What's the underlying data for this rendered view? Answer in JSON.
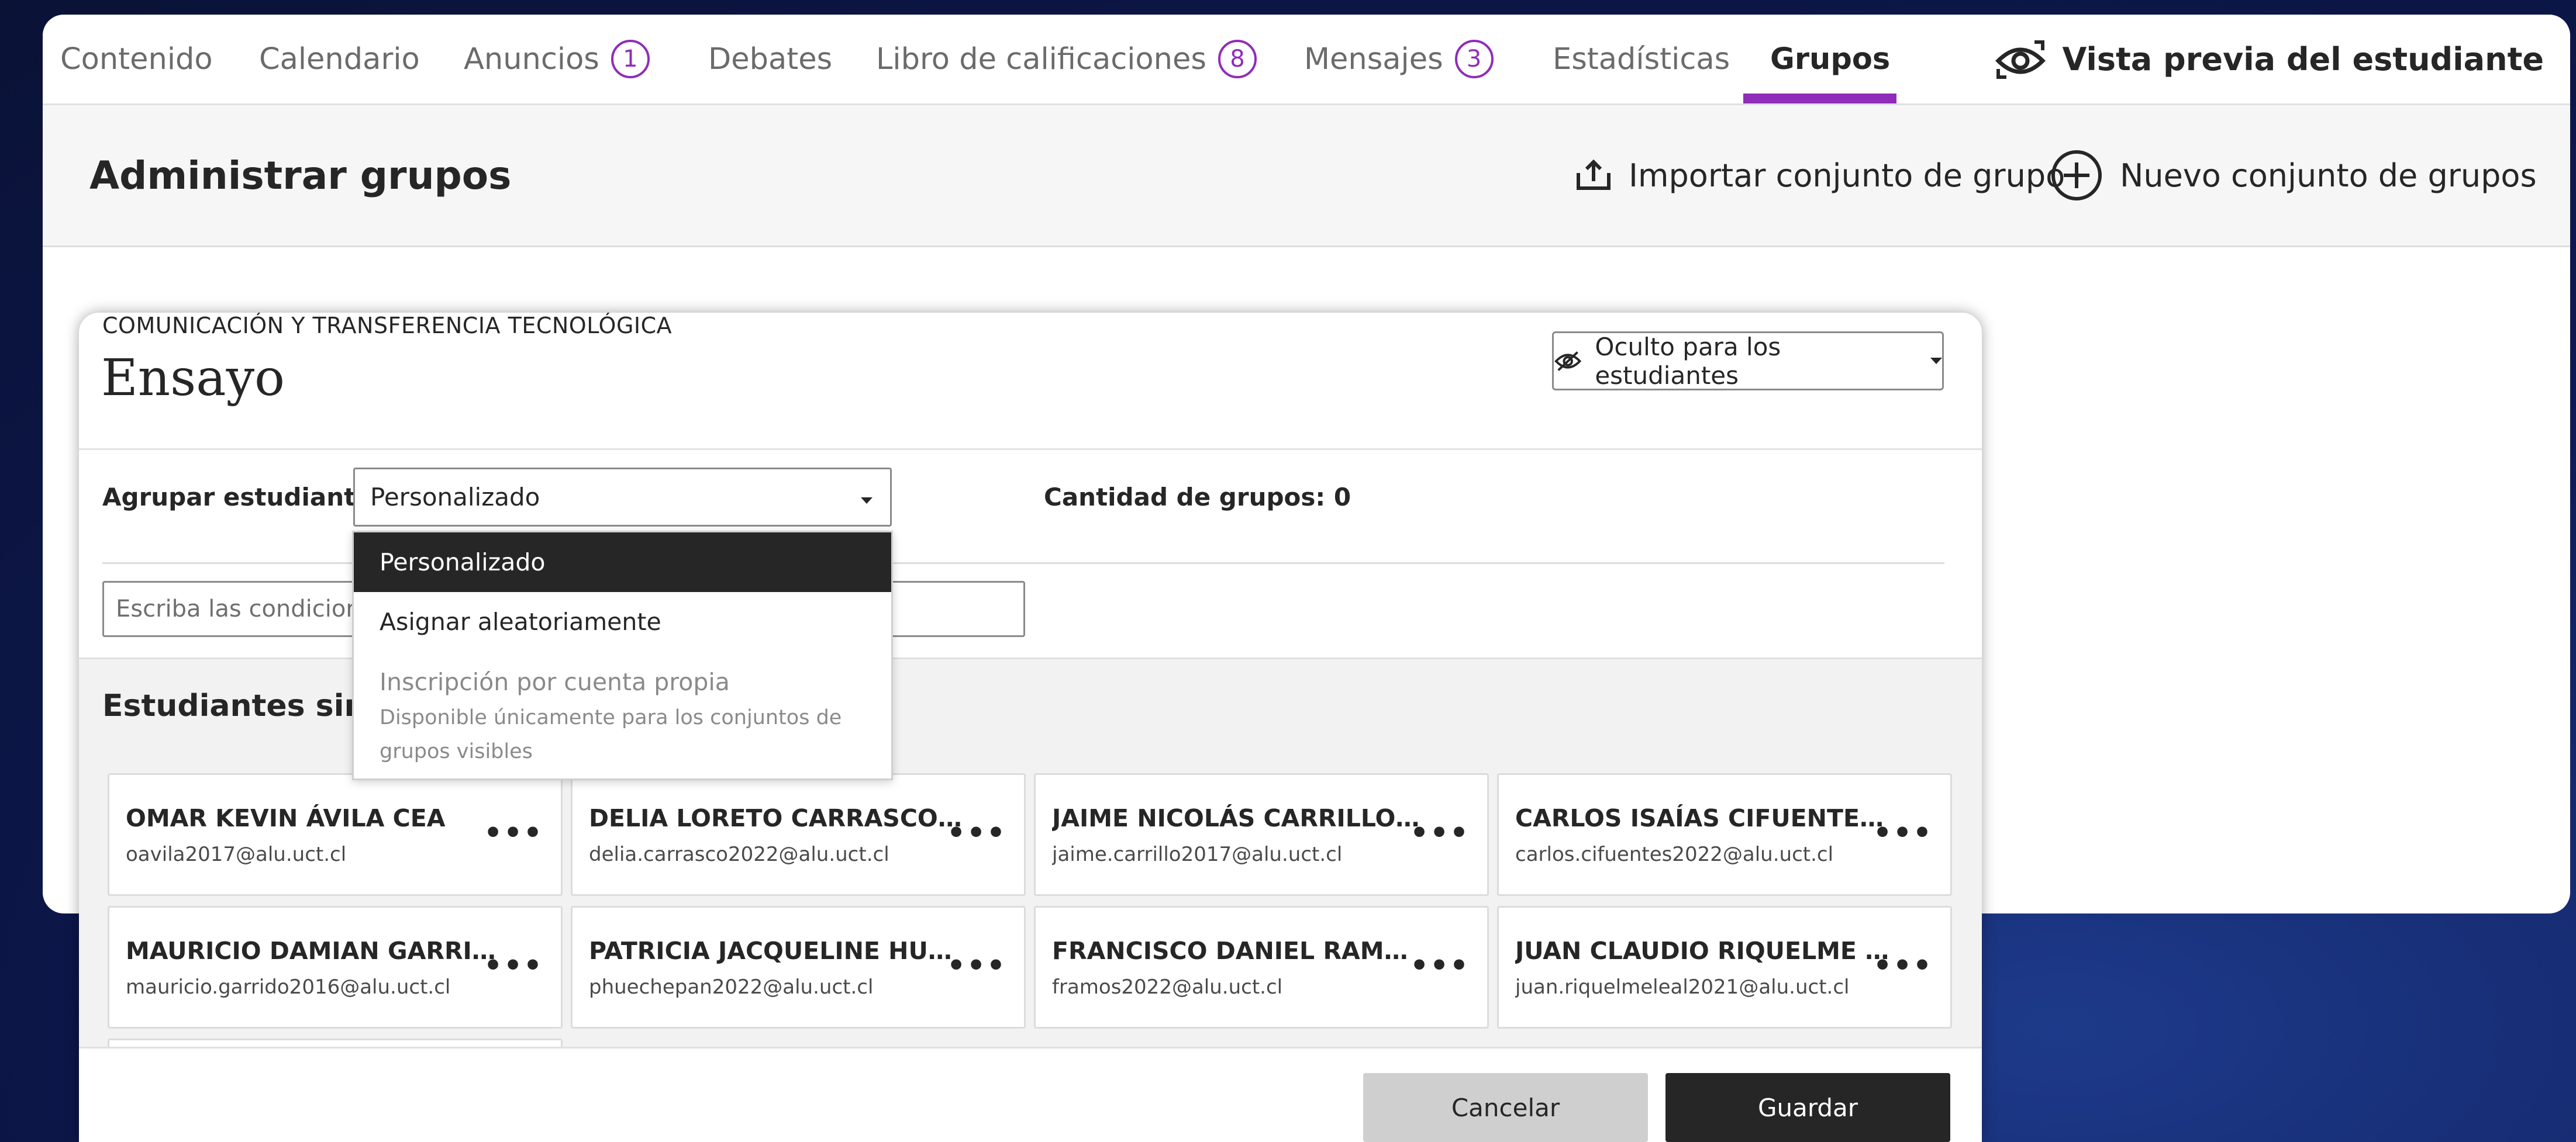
{
  "nav": {
    "tabs": [
      {
        "label": "Contenido"
      },
      {
        "label": "Calendario"
      },
      {
        "label": "Anuncios",
        "badge": "1"
      },
      {
        "label": "Debates"
      },
      {
        "label": "Libro de calificaciones",
        "badge": "8"
      },
      {
        "label": "Mensajes",
        "badge": "3"
      },
      {
        "label": "Estadísticas"
      },
      {
        "label": "Grupos",
        "active": true
      }
    ],
    "preview_label": "Vista previa del estudiante"
  },
  "admin": {
    "title": "Administrar grupos",
    "import_label": "Importar conjunto de grupo",
    "new_label": "Nuevo conjunto de grupos"
  },
  "panel": {
    "subtitle": "COMUNICACIÓN Y TRANSFERENCIA TECNOLÓGICA",
    "title": "Ensayo",
    "visibility_label": "Oculto para los estudiantes",
    "group_students_label": "Agrupar estudiantes",
    "group_select_value": "Personalizado",
    "group_count_label": "Cantidad de grupos: 0",
    "conditions_placeholder": "Escriba las condiciones",
    "unassigned_heading": "Estudiantes sin asignar",
    "cancel_label": "Cancelar",
    "save_label": "Guardar"
  },
  "dropdown": {
    "options": [
      {
        "label": "Personalizado",
        "selected": true
      },
      {
        "label": "Asignar aleatoriamente"
      },
      {
        "label": "Inscripción por cuenta propia",
        "disabled": true
      }
    ],
    "disabled_help": "Disponible únicamente para los conjuntos de grupos visibles"
  },
  "students": [
    {
      "name": "OMAR KEVIN ÁVILA CEA",
      "email": "oavila2017@alu.uct.cl"
    },
    {
      "name": "DELIA LORETO CARRASCO DÍAZ",
      "email": "delia.carrasco2022@alu.uct.cl"
    },
    {
      "name": "JAIME NICOLÁS CARRILLO ELGU...",
      "email": "jaime.carrillo2017@alu.uct.cl"
    },
    {
      "name": "CARLOS ISAÍAS CIFUENTES BÓR...",
      "email": "carlos.cifuentes2022@alu.uct.cl"
    },
    {
      "name": "MAURICIO DAMIAN GARRIDO M...",
      "email": "mauricio.garrido2016@alu.uct.cl"
    },
    {
      "name": "PATRICIA JACQUELINE HUECHEP...",
      "email": "phuechepan2022@alu.uct.cl"
    },
    {
      "name": "FRANCISCO DANIEL RAMOS REU...",
      "email": "framos2022@alu.uct.cl"
    },
    {
      "name": "JUAN CLAUDIO RIQUELME LEAL",
      "email": "juan.riquelmeleal2021@alu.uct.cl"
    }
  ],
  "card_more_label": "•••",
  "colors": {
    "accent": "#8f2db8",
    "dark": "#262626",
    "background_top": "#0a1236",
    "background_glow": "#1d3a8a"
  }
}
